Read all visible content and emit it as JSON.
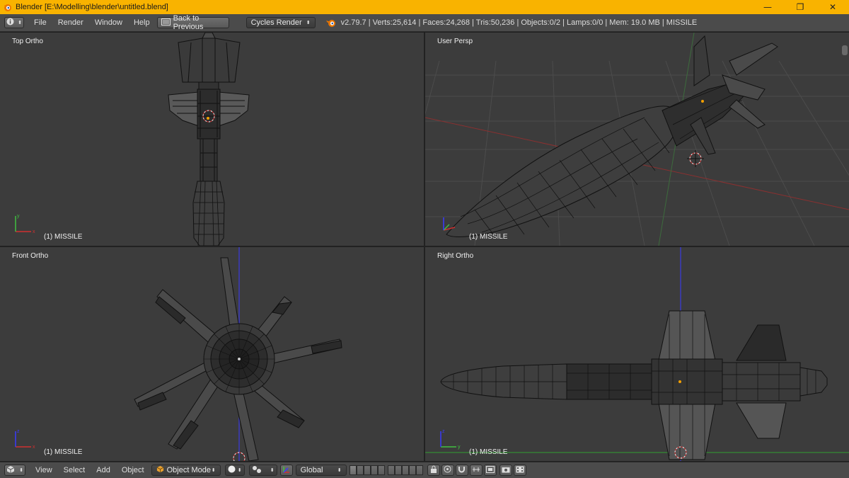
{
  "window": {
    "title": "Blender [E:\\Modelling\\blender\\untitled.blend]",
    "minimize": "—",
    "restore": "❐",
    "close": "✕"
  },
  "info_header": {
    "menus": [
      "File",
      "Render",
      "Window",
      "Help"
    ],
    "back_button": "Back to Previous",
    "render_engine": "Cycles Render",
    "stats": "v2.79.7 | Verts:25,614 | Faces:24,268 | Tris:50,236 | Objects:0/2 | Lamps:0/0 | Mem: 19.0 MB | MISSILE"
  },
  "viewports": [
    {
      "label": "Top Ortho",
      "object": "(1) MISSILE"
    },
    {
      "label": "User Persp",
      "object": "(1) MISSILE"
    },
    {
      "label": "Front Ortho",
      "object": "(1) MISSILE"
    },
    {
      "label": "Right Ortho",
      "object": "(1) MISSILE"
    }
  ],
  "view3d_header": {
    "menus": [
      "View",
      "Select",
      "Add",
      "Object"
    ],
    "mode": "Object Mode",
    "orientation": "Global"
  },
  "colors": {
    "title_bar": "#f9b300",
    "header_bg": "#4b4b4b",
    "viewport_bg": "#3c3c3c",
    "axis_x": "#d03030",
    "axis_y": "#40c040",
    "axis_z": "#3a3aff"
  }
}
